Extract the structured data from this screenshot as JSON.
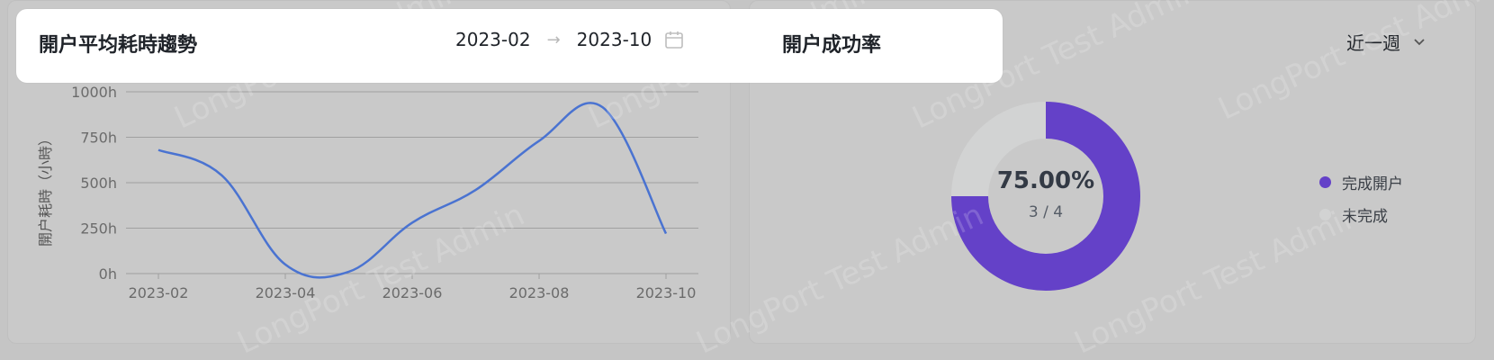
{
  "left_panel": {
    "title": "開户平均耗時趨勢",
    "date_start": "2023-02",
    "date_end": "2023-10",
    "date_separator": "→"
  },
  "right_panel": {
    "title": "開户成功率",
    "period_selected": "近一週",
    "center_value": "75.00%",
    "center_sub": "3 / 4",
    "legend": [
      {
        "label": "完成開户",
        "color": "#6441c8"
      },
      {
        "label": "未完成",
        "color": "#d2d3d3"
      }
    ]
  },
  "watermark_text": "LongPort Test Admin",
  "colors": {
    "line": "#4a73d1",
    "donut_done": "#6441c8",
    "donut_rest": "#d2d3d3"
  },
  "chart_data": [
    {
      "type": "line",
      "ylabel": "開户耗時（小時）",
      "y_ticks": [
        "0h",
        "250h",
        "500h",
        "750h",
        "1000h"
      ],
      "x_ticks": [
        "2023-02",
        "2023-04",
        "2023-06",
        "2023-08",
        "2023-10"
      ],
      "ylim": [
        0,
        1000
      ],
      "grid": true,
      "series": [
        {
          "x": [
            "2023-02",
            "2023-03",
            "2023-04",
            "2023-05",
            "2023-06",
            "2023-07",
            "2023-08",
            "2023-09",
            "2023-10"
          ],
          "values": [
            680,
            540,
            50,
            10,
            280,
            460,
            730,
            915,
            220
          ]
        }
      ]
    },
    {
      "type": "pie",
      "categories": [
        "完成開户",
        "未完成"
      ],
      "values": [
        3,
        1
      ]
    }
  ]
}
